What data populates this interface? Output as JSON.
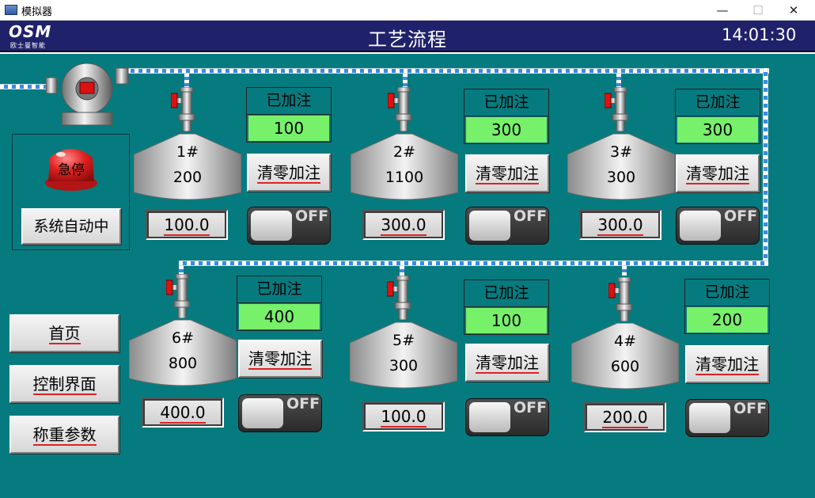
{
  "window": {
    "title": "模拟器",
    "minimize": "—",
    "maximize": "☐",
    "close": "✕"
  },
  "header": {
    "logo": "OSM",
    "logo_sub": "欧士曼智能",
    "title": "工艺流程",
    "time": "14:01:30"
  },
  "panel": {
    "estop_label": "急停",
    "auto_label": "系统自动中"
  },
  "nav": [
    {
      "label": "首页"
    },
    {
      "label": "控制界面"
    },
    {
      "label": "称重参数"
    }
  ],
  "tanks": [
    {
      "name": "1#",
      "level": "200",
      "filled_title": "已加注",
      "filled_value": "100",
      "clear_label": "清零加注",
      "weight": "100.0",
      "switch": "OFF"
    },
    {
      "name": "2#",
      "level": "1100",
      "filled_title": "已加注",
      "filled_value": "300",
      "clear_label": "清零加注",
      "weight": "300.0",
      "switch": "OFF"
    },
    {
      "name": "3#",
      "level": "300",
      "filled_title": "已加注",
      "filled_value": "300",
      "clear_label": "清零加注",
      "weight": "300.0",
      "switch": "OFF"
    },
    {
      "name": "6#",
      "level": "800",
      "filled_title": "已加注",
      "filled_value": "400",
      "clear_label": "清零加注",
      "weight": "400.0",
      "switch": "OFF"
    },
    {
      "name": "5#",
      "level": "300",
      "filled_title": "已加注",
      "filled_value": "100",
      "clear_label": "清零加注",
      "weight": "100.0",
      "switch": "OFF"
    },
    {
      "name": "4#",
      "level": "600",
      "filled_title": "已加注",
      "filled_value": "200",
      "clear_label": "清零加注",
      "weight": "200.0",
      "switch": "OFF"
    }
  ],
  "colors": {
    "background": "#067b7f",
    "header": "#20216b",
    "filled_value": "#77f06a",
    "estop": "#e0201f"
  }
}
